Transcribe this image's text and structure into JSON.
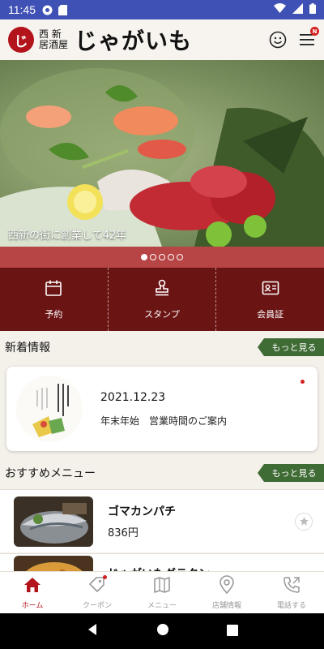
{
  "status_bar": {
    "time": "11:45"
  },
  "header": {
    "logo_mark": "じ",
    "logo_sub_line1": "西 新",
    "logo_sub_line2": "居酒屋",
    "logo_main": "じゃがいも"
  },
  "hero": {
    "caption": "西新の街に創業して42年",
    "slide_count": 5,
    "active_slide": 1
  },
  "actions": [
    {
      "label": "予約",
      "icon": "calendar-icon"
    },
    {
      "label": "スタンプ",
      "icon": "stamp-icon"
    },
    {
      "label": "会員証",
      "icon": "member-card-icon"
    }
  ],
  "news": {
    "heading": "新着情報",
    "more_label": "もっと見る",
    "item": {
      "date": "2021.12.23",
      "title": "年末年始　営業時間のご案内",
      "unread": true
    }
  },
  "recommended": {
    "heading": "おすすめメニュー",
    "more_label": "もっと見る",
    "items": [
      {
        "name": "ゴマカンパチ",
        "price": "836円"
      },
      {
        "name": "じゃがいもグラタン",
        "price": ""
      }
    ]
  },
  "bottom_nav": [
    {
      "label": "ホーム",
      "icon": "home-icon",
      "active": true
    },
    {
      "label": "クーポン",
      "icon": "coupon-icon",
      "active": false,
      "badge": true
    },
    {
      "label": "メニュー",
      "icon": "menu-book-icon",
      "active": false
    },
    {
      "label": "店舗情報",
      "icon": "location-icon",
      "active": false
    },
    {
      "label": "電話する",
      "icon": "phone-icon",
      "active": false
    }
  ],
  "colors": {
    "status_bar": "#3f51b5",
    "brand_red": "#b3141c",
    "action_bar": "#6b1414",
    "dots_bar": "#b74545",
    "more_button": "#3f6b35"
  }
}
